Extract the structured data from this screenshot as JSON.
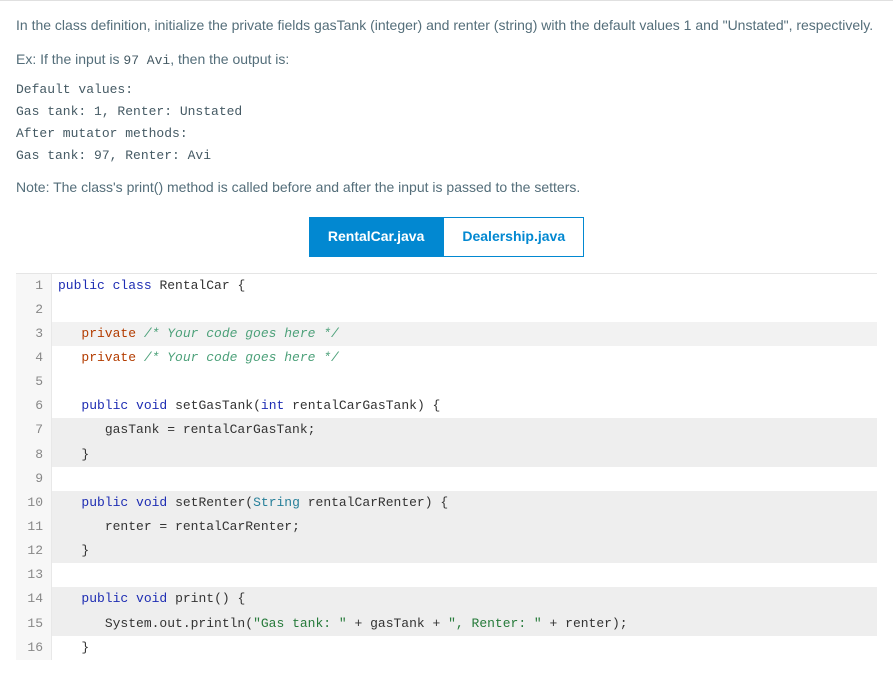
{
  "prompt": {
    "p1": "In the class definition, initialize the private fields gasTank (integer) and renter (string) with the default values 1 and \"Unstated\", respectively.",
    "ex_prefix": "Ex: If the input is ",
    "ex_code": "97 Avi",
    "ex_suffix": ", then the output is:",
    "sample": "Default values:\nGas tank: 1, Renter: Unstated\nAfter mutator methods:\nGas tank: 97, Renter: Avi",
    "note": "Note: The class's print() method is called before and after the input is passed to the setters."
  },
  "tabs": {
    "active": "RentalCar.java",
    "inactive": "Dealership.java"
  },
  "code": {
    "l1": {
      "n": "1"
    },
    "l2": {
      "n": "2"
    },
    "l3": {
      "n": "3"
    },
    "l4": {
      "n": "4"
    },
    "l5": {
      "n": "5"
    },
    "l6": {
      "n": "6"
    },
    "l7": {
      "n": "7"
    },
    "l8": {
      "n": "8"
    },
    "l9": {
      "n": "9"
    },
    "l10": {
      "n": "10"
    },
    "l11": {
      "n": "11"
    },
    "l12": {
      "n": "12"
    },
    "l13": {
      "n": "13"
    },
    "l14": {
      "n": "14"
    },
    "l15": {
      "n": "15"
    },
    "l16": {
      "n": "16"
    }
  },
  "tok": {
    "public": "public",
    "class": "class",
    "RentalCar": "RentalCar",
    "private": "private",
    "void": "void",
    "int": "int",
    "String": "String",
    "openBrace": "{",
    "closeBrace": "}",
    "comment_placeholder": "/* Your code goes here */",
    "setGasTank": "setGasTank",
    "rentalCarGasTank": "rentalCarGasTank",
    "gasTank": "gasTank",
    "setRenter": "setRenter",
    "rentalCarRenter": "rentalCarRenter",
    "renter": "renter",
    "print": "print",
    "System_out_println": "System.out.println",
    "str_gastank": "\"Gas tank: \"",
    "str_renter": "\", Renter: \"",
    "plus": " + ",
    "paren_open": "(",
    "paren_close": ")",
    "paren_close_semi": ");",
    "paren_close_brace": ") {",
    "assign": " = ",
    "semi": ";",
    "sp1": " ",
    "indent1": "   ",
    "indent2": "      "
  }
}
